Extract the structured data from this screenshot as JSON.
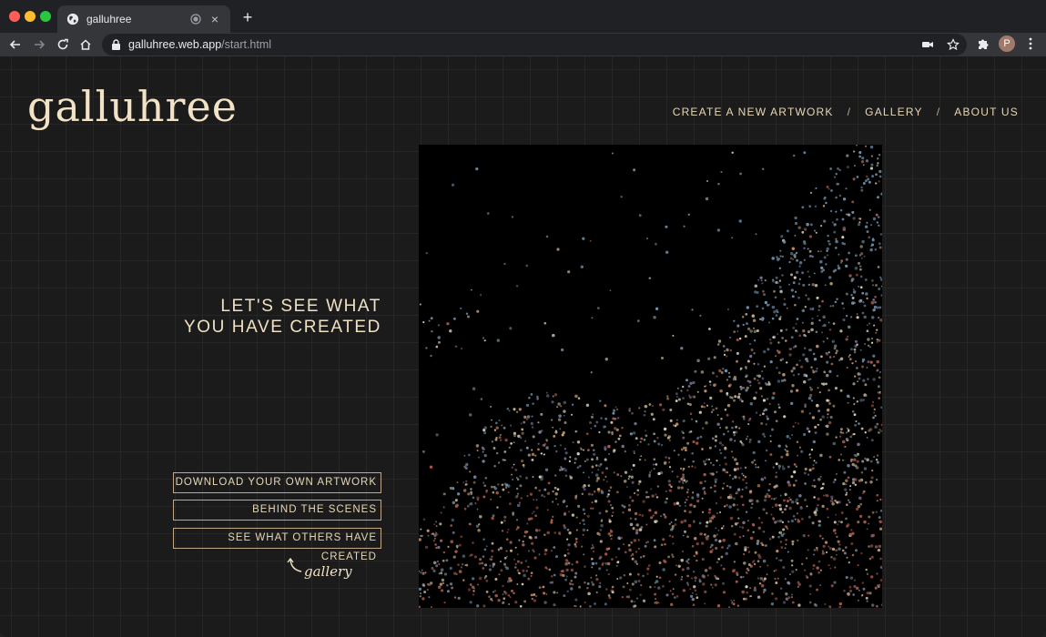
{
  "browser": {
    "tab_title": "galluhree",
    "new_tab_symbol": "+",
    "close_symbol": "×",
    "url_host": "galluhree.web.app",
    "url_path": "/start.html",
    "profile_initial": "P"
  },
  "header": {
    "logo": "galluhree",
    "nav": [
      "CREATE A NEW ARTWORK",
      "GALLERY",
      "ABOUT US"
    ],
    "nav_separator": "/"
  },
  "main": {
    "headline_line1": "LET'S SEE WHAT",
    "headline_line2": "YOU HAVE CREATED",
    "buttons": [
      "DOWNLOAD YOUR OWN ARTWORK",
      "BEHIND THE SCENES",
      "SEE WHAT OTHERS HAVE CREATED"
    ],
    "annotation": "gallery"
  },
  "colors": {
    "background": "#1b1b1b",
    "accent_cream": "#f0e1c4",
    "button_border": "#bfa98a",
    "artwork_palette": [
      "#c9b48a",
      "#6f8fa8",
      "#a65a4a",
      "#d8cfb8",
      "#7a6d8e",
      "#b88e6a",
      "#5d7b88"
    ]
  }
}
